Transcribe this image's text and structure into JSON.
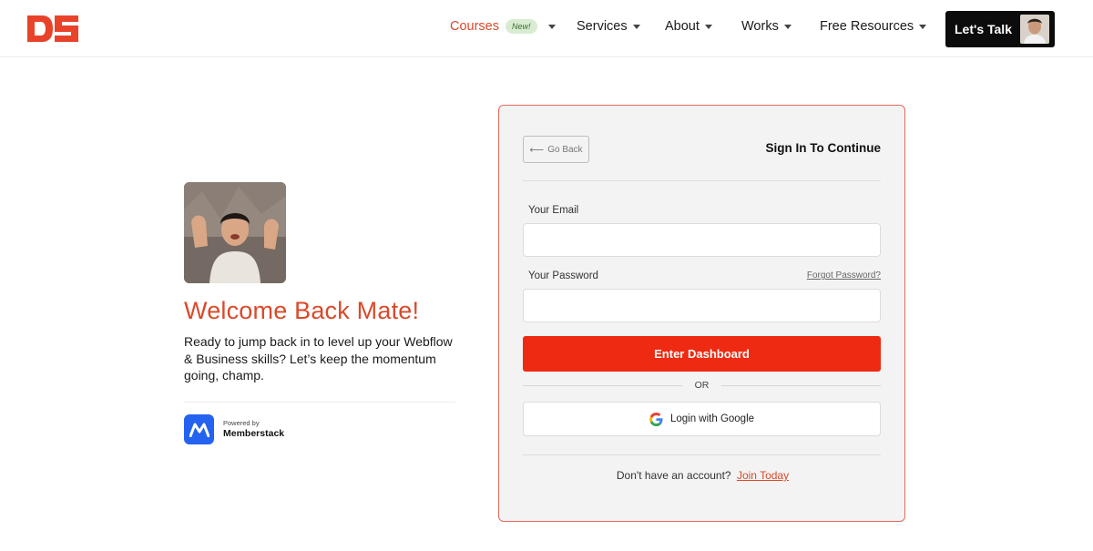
{
  "header": {
    "logo_text": "DS",
    "nav": [
      {
        "label": "Courses",
        "badge": "New!"
      },
      {
        "label": "Services"
      },
      {
        "label": "About"
      },
      {
        "label": "Works"
      },
      {
        "label": "Free Resources"
      }
    ],
    "cta_label": "Let's Talk"
  },
  "welcome": {
    "title": "Welcome Back Mate!",
    "text": "Ready to jump back in to level up your Webflow & Business skills? Let’s keep the momentum going, champ.",
    "powered_by": "Powered by",
    "provider": "Memberstack"
  },
  "signin": {
    "back_label": "Go Back",
    "title": "Sign In To Continue",
    "email_label": "Your Email",
    "email_value": "",
    "password_label": "Your Password",
    "password_value": "",
    "forgot_label": "Forgot Password?",
    "submit_label": "Enter Dashboard",
    "or_label": "OR",
    "google_label": "Login with Google",
    "no_account_text": "Don't have an account?",
    "join_label": "Join Today"
  },
  "colors": {
    "brand": "#d94a2b",
    "primary_button": "#ee2a12",
    "card_border": "#e46a5d",
    "cta_background": "#0c0c0c",
    "memberstack_blue": "#2462f0"
  }
}
